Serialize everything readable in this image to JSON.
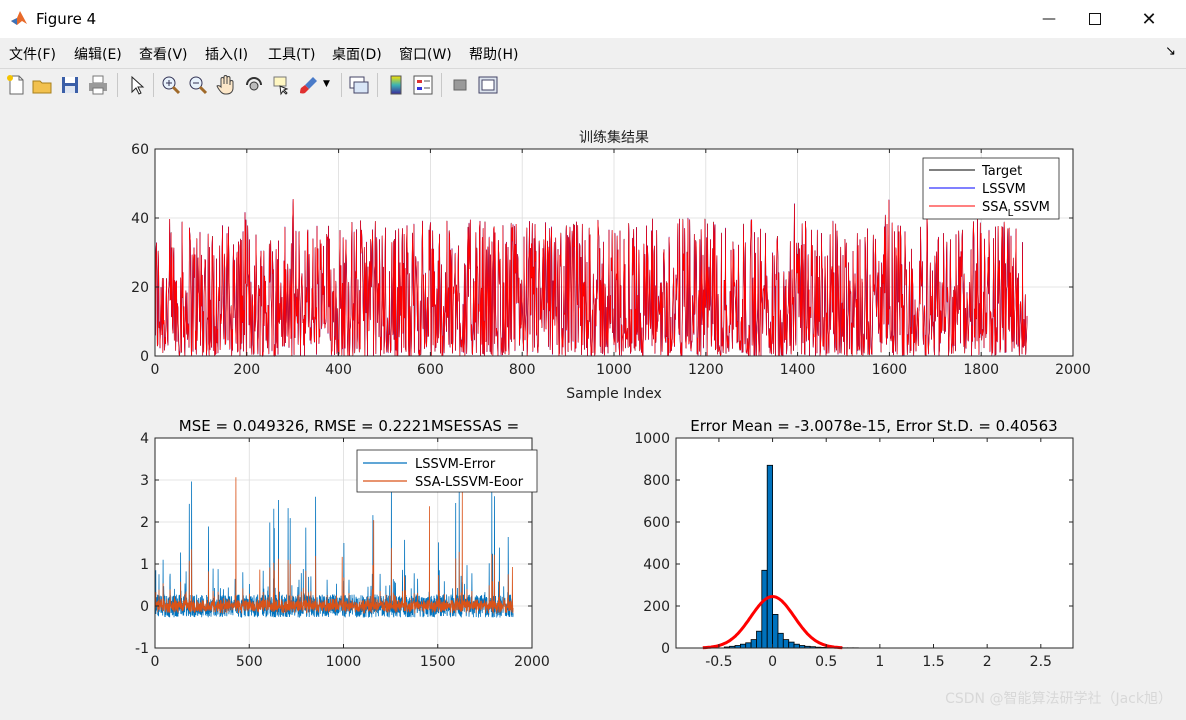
{
  "window": {
    "title": "Figure 4"
  },
  "menu": [
    "文件(F)",
    "编辑(E)",
    "查看(V)",
    "插入(I)",
    "工具(T)",
    "桌面(D)",
    "窗口(W)",
    "帮助(H)"
  ],
  "toolbar_icons": [
    "new-figure-icon",
    "open-file-icon",
    "save-icon",
    "print-icon",
    "pointer-icon",
    "zoom-in-icon",
    "zoom-out-icon",
    "pan-icon",
    "rotate-3d-icon",
    "data-cursor-icon",
    "brush-icon",
    "link-plot-icon",
    "colorbar-icon",
    "legend-icon",
    "hide-plot-tools-icon",
    "show-plot-tools-icon"
  ],
  "watermark": "CSDN @智能算法研学社（Jack旭）",
  "colors": {
    "target": "#000000",
    "lssvm": "#0000ff",
    "ssa": "#ff0000",
    "err1": "#0072bd",
    "err2": "#d95319",
    "fit": "#ff0000",
    "bars": "#0072bd"
  },
  "chart_data": [
    {
      "type": "line",
      "title": "训练集结果",
      "xlabel": "Sample Index",
      "ylabel": "",
      "xlim": [
        0,
        2000
      ],
      "ylim": [
        0,
        60
      ],
      "xticks": [
        0,
        200,
        400,
        600,
        800,
        1000,
        1200,
        1400,
        1600,
        1800,
        2000
      ],
      "yticks": [
        0,
        20,
        40,
        60
      ],
      "grid": true,
      "legend_position": "top-right",
      "series": [
        {
          "name": "Target",
          "n_points": 1900,
          "value_range": [
            0,
            49
          ]
        },
        {
          "name": "LSSVM",
          "n_points": 1900,
          "value_range": [
            0,
            49
          ]
        },
        {
          "name": "SSA_LSSVM",
          "legend_text": "SSA",
          "legend_sub": "L",
          "legend_rest": "SSVM",
          "n_points": 1900,
          "value_range": [
            0,
            49
          ]
        }
      ]
    },
    {
      "type": "line",
      "title": "MSE = 0.049326, RMSE = 0.2221MSESSAS =",
      "xlim": [
        0,
        2000
      ],
      "ylim": [
        -1,
        4
      ],
      "xticks": [
        0,
        500,
        1000,
        1500,
        2000
      ],
      "yticks": [
        -1,
        0,
        1,
        2,
        3,
        4
      ],
      "grid": true,
      "legend_position": "top-right",
      "series": [
        {
          "name": "LSSVM-Error",
          "n_points": 1900,
          "value_range": [
            -0.8,
            3.1
          ]
        },
        {
          "name": "SSA-LSSVM-Eoor",
          "n_points": 1900,
          "value_range": [
            -0.8,
            3.1
          ]
        }
      ]
    },
    {
      "type": "bar",
      "title": "Error Mean = -3.0078e-15, Error St.D. = 0.40563",
      "xlim": [
        -0.9,
        2.8
      ],
      "ylim": [
        0,
        1000
      ],
      "xticks": [
        -0.5,
        0,
        0.5,
        1,
        1.5,
        2,
        2.5
      ],
      "xticklabels": [
        "-0.5",
        "0",
        "0.5",
        "1",
        "1.5",
        "2",
        "2.5"
      ],
      "yticks": [
        0,
        200,
        400,
        600,
        800,
        1000
      ],
      "grid": false,
      "bin_width": 0.05,
      "bin_starts": [
        -0.45,
        -0.4,
        -0.35,
        -0.3,
        -0.25,
        -0.2,
        -0.15,
        -0.1,
        -0.05,
        0.0,
        0.05,
        0.1,
        0.15,
        0.2,
        0.25,
        0.3,
        0.35,
        0.4,
        0.45,
        0.5,
        0.55,
        0.6,
        0.65,
        0.7,
        0.75
      ],
      "counts": [
        5,
        8,
        12,
        18,
        25,
        40,
        80,
        370,
        870,
        160,
        70,
        40,
        28,
        18,
        12,
        8,
        6,
        4,
        3,
        3,
        2,
        2,
        1,
        1,
        1
      ],
      "fit": {
        "name": "normal fit",
        "mean": 0.0,
        "sd": 0.40563,
        "peak": 245
      }
    }
  ]
}
